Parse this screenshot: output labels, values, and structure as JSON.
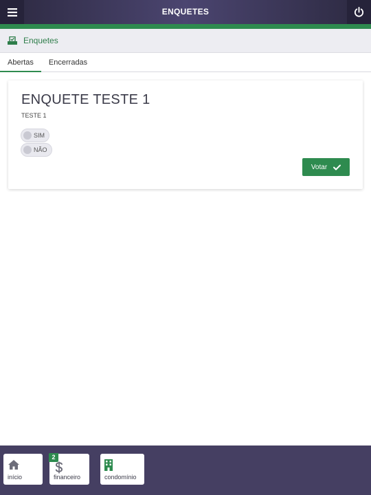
{
  "header": {
    "title": "ENQUETES",
    "menu_icon": "hamburger-menu-icon",
    "power_icon": "power-icon"
  },
  "section": {
    "label": "Enquetes",
    "icon": "ballot-box-icon"
  },
  "tabs": [
    {
      "label": "Abertas",
      "active": true
    },
    {
      "label": "Encerradas",
      "active": false
    }
  ],
  "poll": {
    "title": "ENQUETE TESTE 1",
    "subtitle": "TESTE 1",
    "options": [
      {
        "label": "SIM",
        "selected": false
      },
      {
        "label": "NÃO",
        "selected": false
      }
    ],
    "vote_label": "Votar",
    "vote_icon": "check-icon"
  },
  "bottom_nav": [
    {
      "label": "início",
      "icon": "home-icon"
    },
    {
      "label": "financeiro",
      "icon": "dollar-icon",
      "badge": "2"
    },
    {
      "label": "condomínio",
      "icon": "building-icon"
    }
  ],
  "colors": {
    "accent": "#2e8b4f",
    "topbar": "#3a355a",
    "bottombar": "#453f62"
  }
}
